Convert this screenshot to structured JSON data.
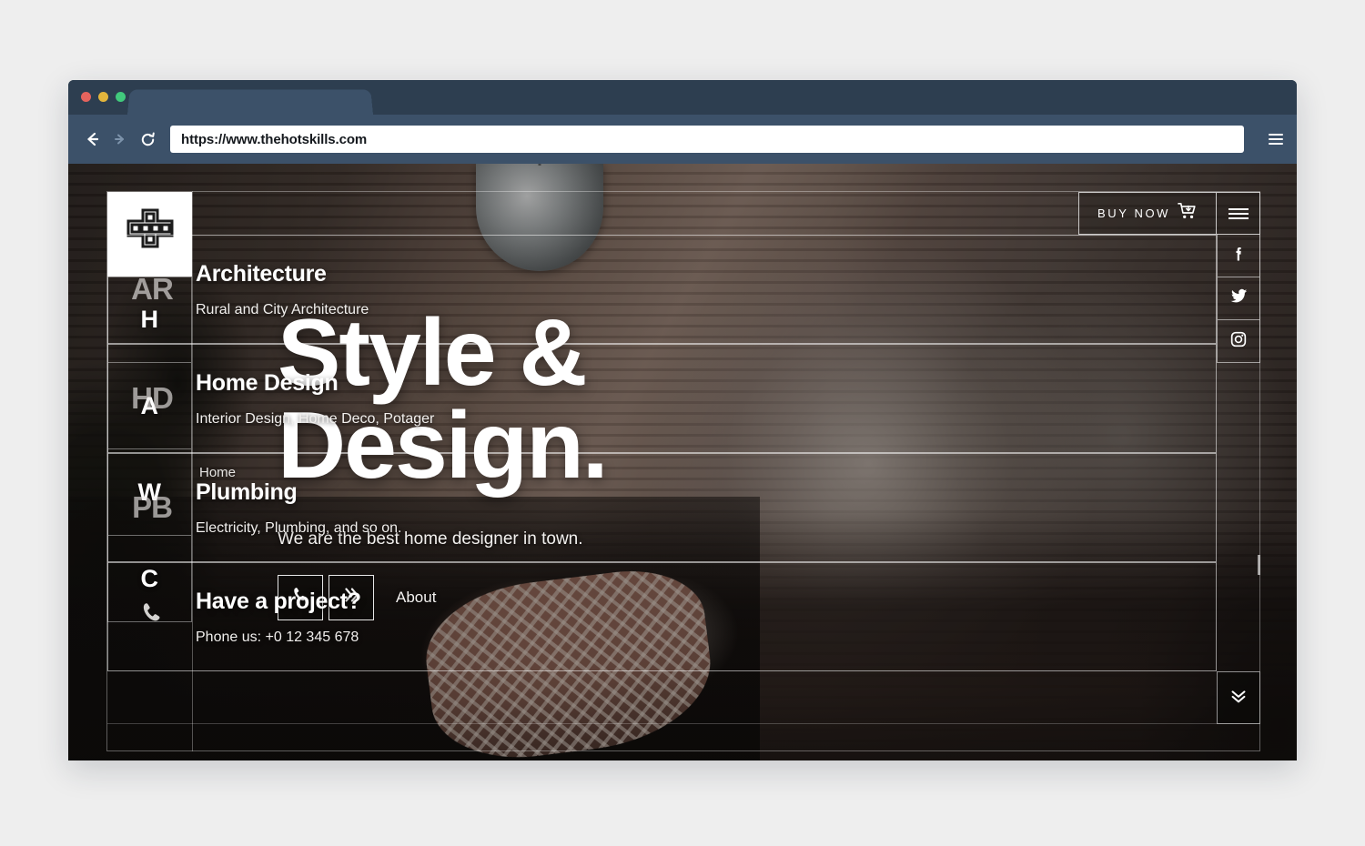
{
  "browser": {
    "url": "https://www.thehotskills.com",
    "back_icon": "back-arrow-icon",
    "forward_icon": "forward-arrow-icon",
    "reload_icon": "reload-icon",
    "menu_icon": "hamburger-menu-icon",
    "traffic_lights": [
      "close-red",
      "minimize-yellow",
      "maximize-green"
    ]
  },
  "site": {
    "logo_icon": "cross-grid-logo",
    "breadcrumb": "Home",
    "vertical_nav": [
      {
        "letter": "H"
      },
      {
        "letter": "A"
      },
      {
        "letter": "W"
      },
      {
        "letter": "C"
      }
    ],
    "hero": {
      "line1": "Style &",
      "line2": "Design.",
      "subtitle": "We are the best home designer in town.",
      "phone_button_icon": "phone-icon",
      "next_button_icon": "double-chevron-right-icon",
      "about_label": "About"
    },
    "buy_now": {
      "label": "BUY NOW",
      "cart_icon": "shopping-cart-icon"
    },
    "menu_button_icon": "hamburger-menu-icon",
    "social": [
      {
        "name": "facebook",
        "icon": "facebook-icon"
      },
      {
        "name": "twitter",
        "icon": "twitter-icon"
      },
      {
        "name": "instagram",
        "icon": "instagram-icon"
      }
    ],
    "services": [
      {
        "abbr": "AR",
        "title": "Architecture",
        "description": "Rural and City Architecture"
      },
      {
        "abbr": "HD",
        "title": "Home Design",
        "description": "Interior Design, Home Deco, Potager"
      },
      {
        "abbr": "PB",
        "title": "Plumbing",
        "description": "Electricity, Plumbing, and so on."
      }
    ],
    "contact": {
      "icon": "phone-icon",
      "title": "Have a project?",
      "description": "Phone us: +0 12 345 678"
    },
    "scroll_down_icon": "double-chevron-down-icon"
  },
  "colors": {
    "browser_chrome": "#2d3e50",
    "browser_toolbar": "#3c5169",
    "page_background": "#eeeeee",
    "accent_white": "#ffffff",
    "light_red": "#e4635d",
    "light_yellow": "#e2b53c",
    "light_green": "#41c97c"
  }
}
